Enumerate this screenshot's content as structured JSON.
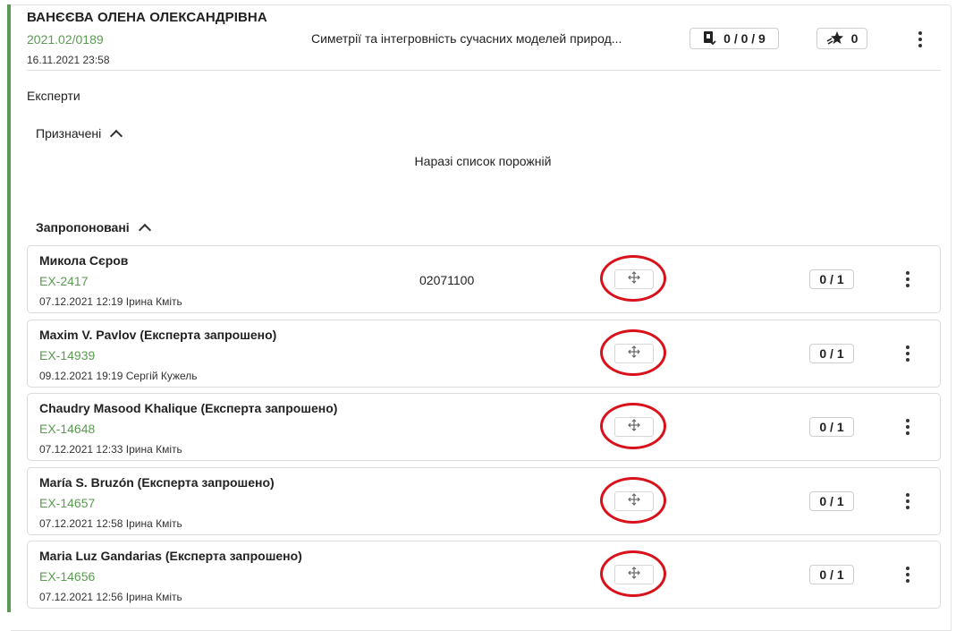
{
  "header": {
    "name": "ВАНЄЄВА ОЛЕНА ОЛЕКСАНДРІВНА",
    "code": "2021.02/0189",
    "date": "16.11.2021 23:58",
    "title": "Симетрії та інтегровність сучасних моделей природ...",
    "reviews_count": "0 / 0 / 9",
    "rating_count": "0",
    "reviews_icon": "bookmark-doc-icon",
    "rating_icon": "star-burst-icon"
  },
  "experts_section": {
    "title": "Експерти",
    "assigned_label": "Призначені",
    "assigned_empty": "Наразі список порожній",
    "proposed_label": "Запропоновані"
  },
  "proposed": [
    {
      "name": "Микола Сєров",
      "code": "EX-2417",
      "meta": "07.12.2021 12:19 Ірина Кміть",
      "number": "02071100",
      "score": "0 / 1"
    },
    {
      "name": "Maxim V. Pavlov (Експерта запрошено)",
      "code": "EX-14939",
      "meta": "09.12.2021 19:19 Сергій Кужель",
      "number": "",
      "score": "0 / 1"
    },
    {
      "name": "Chaudry Masood Khalique (Експерта запрошено)",
      "code": "EX-14648",
      "meta": "07.12.2021 12:33 Ірина Кміть",
      "number": "",
      "score": "0 / 1"
    },
    {
      "name": "María S. Bruzón (Експерта запрошено)",
      "code": "EX-14657",
      "meta": "07.12.2021 12:58 Ірина Кміть",
      "number": "",
      "score": "0 / 1"
    },
    {
      "name": "Maria Luz Gandarias (Експерта запрошено)",
      "code": "EX-14656",
      "meta": "07.12.2021 12:56 Ірина Кміть",
      "number": "",
      "score": "0 / 1"
    }
  ],
  "colors": {
    "accent_green": "#5b9a52",
    "highlight_red": "#d9111b"
  }
}
